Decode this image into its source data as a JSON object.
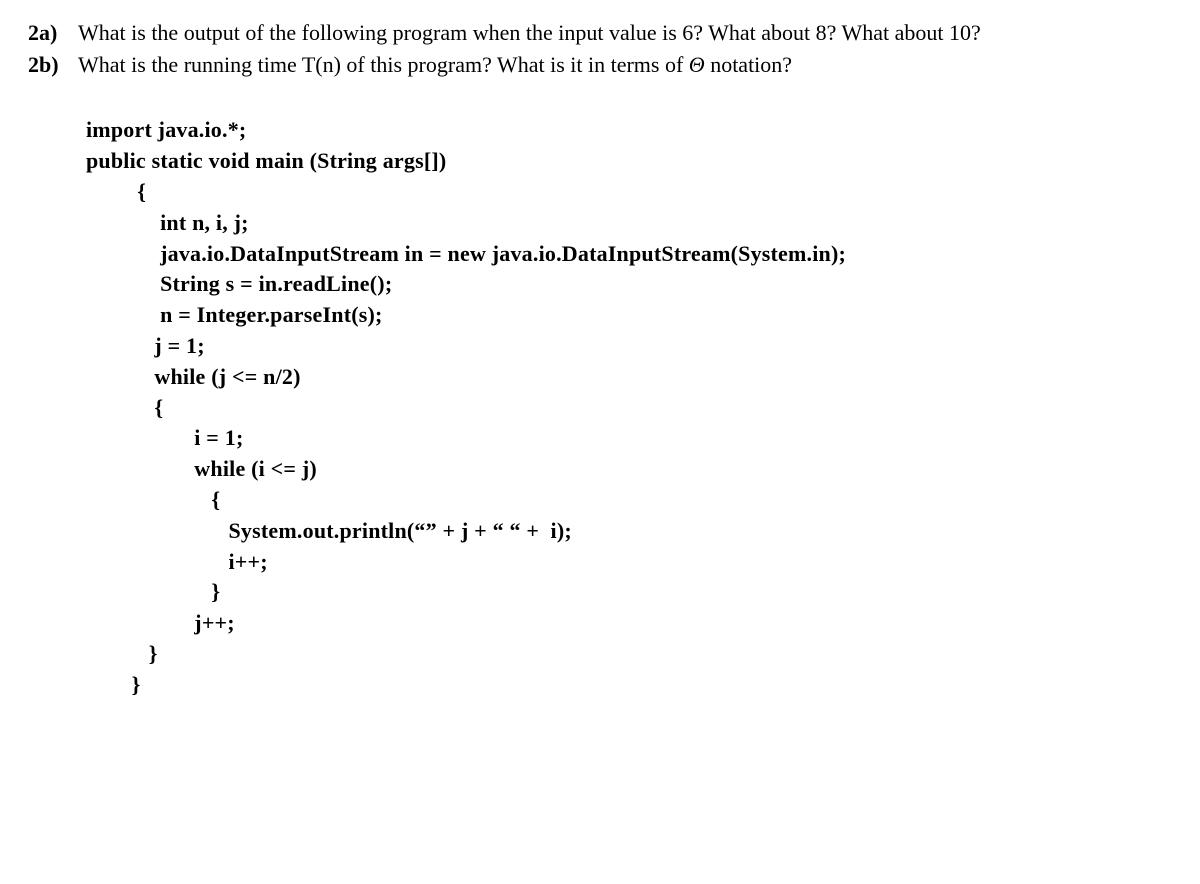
{
  "questions": {
    "q2a": {
      "label": "2a)",
      "text": "What is the output of the following program when the input value is 6?  What about 8?  What about 10?"
    },
    "q2b": {
      "label": "2b)",
      "text_part1": "What is the running time T(n) of this program?  What is it in terms of ",
      "theta": "Θ",
      "text_part2": "  notation?"
    }
  },
  "code": "import java.io.*;\npublic static void main (String args[])\n         {\n             int n, i, j;\n             java.io.DataInputStream in = new java.io.DataInputStream(System.in);\n             String s = in.readLine();\n             n = Integer.parseInt(s);\n            j = 1;\n            while (j <= n/2)\n            {\n                   i = 1;\n                   while (i <= j)\n                      {\n                         System.out.println(“” + j + “ “ +  i);\n                         i++;\n                      }\n                   j++;\n           }\n        }"
}
